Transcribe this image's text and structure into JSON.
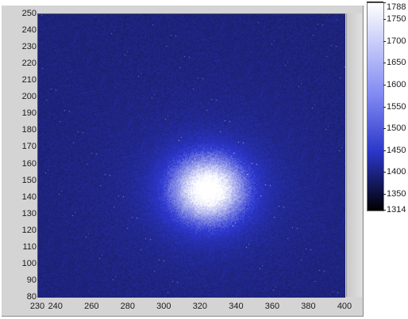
{
  "chart_data": {
    "type": "heatmap",
    "x_ticks": [
      230,
      240,
      260,
      280,
      300,
      320,
      340,
      360,
      380,
      400
    ],
    "x_range": [
      230,
      400
    ],
    "y_ticks": [
      80,
      90,
      100,
      110,
      120,
      130,
      140,
      150,
      160,
      170,
      180,
      190,
      200,
      210,
      220,
      230,
      240,
      250
    ],
    "y_range": [
      80,
      250
    ],
    "colorbar": {
      "ticks": [
        "1788",
        "1750",
        "1700",
        "1650",
        "1600",
        "1550",
        "1500",
        "1450",
        "1400",
        "1350",
        "1314"
      ],
      "range": [
        1314,
        1788
      ]
    },
    "colors": {
      "low": "#000000",
      "mid": "#2b36c8",
      "high": "#ffffff"
    }
  }
}
